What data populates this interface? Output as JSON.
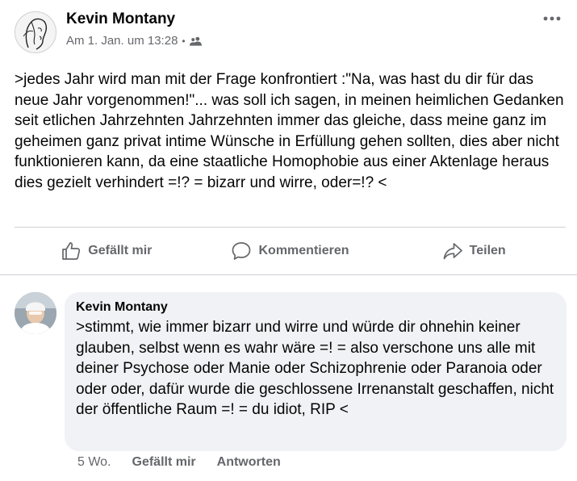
{
  "post": {
    "author": "Kevin Montany",
    "timestamp": "Am 1. Jan. um 13:28",
    "separator": "•",
    "audience_icon": "friends-icon",
    "more_icon": "more-options-icon",
    "body": ">jedes Jahr wird man mit der Frage konfrontiert :\"Na, was hast du dir für das neue Jahr vorgenommen!\"... was soll ich sagen, in meinen heimlichen Gedanken seit etlichen Jahrzehnten Jahrzehnten immer das gleiche, dass meine ganz im geheimen ganz privat intime Wünsche in Erfüllung gehen sollten, dies aber nicht funktionieren kann, da eine staatliche Homophobie aus einer Aktenlage heraus dies gezielt verhindert =!? = bizarr und wirre, oder=!? <"
  },
  "actions": {
    "like": "Gefällt mir",
    "comment": "Kommentieren",
    "share": "Teilen"
  },
  "comment": {
    "author": "Kevin Montany",
    "text": ">stimmt, wie immer bizarr und wirre und würde dir ohnehin keiner glauben, selbst wenn es wahr wäre =! = also verschone uns alle mit deiner Psychose oder Manie oder Schizophrenie oder Paranoia oder oder oder, dafür wurde die geschlossene Irrenanstalt geschaffen, nicht der öffentliche Raum =! = du idiot, RIP <",
    "age": "5 Wo.",
    "like": "Gefällt mir",
    "reply": "Antworten"
  },
  "colors": {
    "secondary_text": "#65676b",
    "bubble_bg": "#f0f2f5",
    "divider": "#ced0d4"
  }
}
